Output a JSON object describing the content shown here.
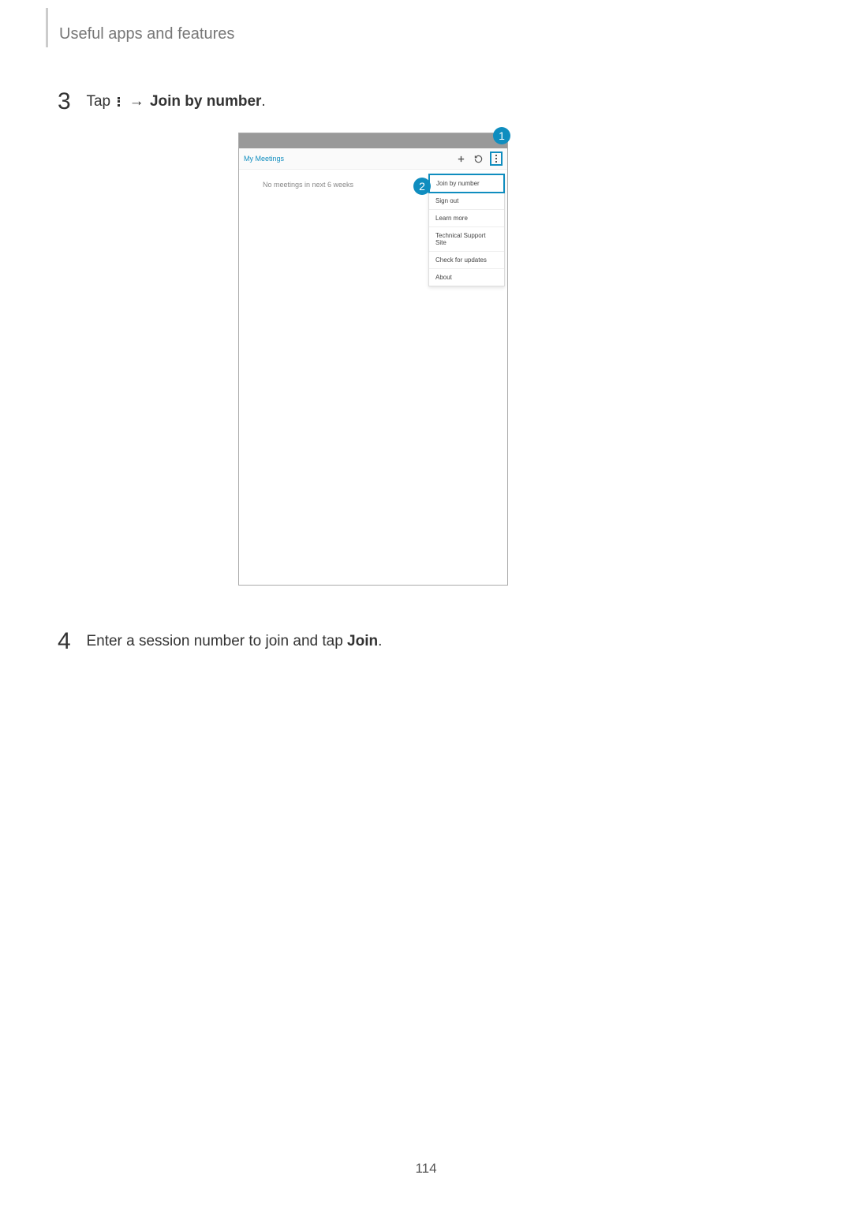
{
  "section_title": "Useful apps and features",
  "steps": {
    "s3_number": "3",
    "s3_prefix": "Tap ",
    "s3_arrow": " → ",
    "s3_bold": "Join by number",
    "s3_period": ".",
    "s4_number": "4",
    "s4_prefix": "Enter a session number to join and tap ",
    "s4_bold": "Join",
    "s4_period": "."
  },
  "badges": {
    "b1": "1",
    "b2": "2"
  },
  "toolbar": {
    "title": "My Meetings"
  },
  "body": {
    "no_meetings": "No meetings in next 6 weeks"
  },
  "dropdown": {
    "items": {
      "i0": "Join by number",
      "i1": "Sign out",
      "i2": "Learn more",
      "i3": "Technical Support Site",
      "i4": "Check for updates",
      "i5": "About"
    }
  },
  "page_number": "114"
}
